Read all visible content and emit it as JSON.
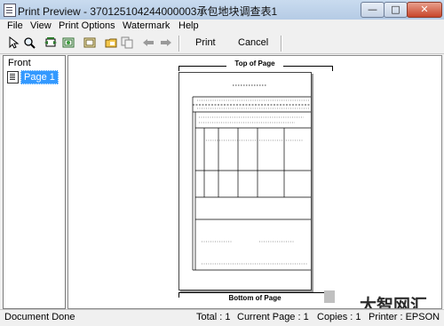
{
  "window": {
    "title": "Print Preview - 370125104244000003承包地块调查表1",
    "controls": {
      "minimize": "—",
      "maximize": "□",
      "close": "✕"
    }
  },
  "menu": [
    "File",
    "View",
    "Print Options",
    "Watermark",
    "Help"
  ],
  "toolbar": {
    "icons": [
      "pointer-icon",
      "zoom-icon",
      "fit-width-icon",
      "image-icon",
      "page-icon",
      "folder-icon",
      "copy-icon",
      "back-arrow-icon",
      "forward-arrow-icon"
    ],
    "print_label": "Print",
    "cancel_label": "Cancel"
  },
  "tree": {
    "root_label": "Front",
    "items": [
      {
        "label": "Page 1",
        "selected": true
      }
    ]
  },
  "preview": {
    "top_marker": "Top of Page",
    "bottom_marker": "Bottom of Page"
  },
  "watermark_text": "大智网汇",
  "status": {
    "message": "Document Done",
    "total": "Total : 1",
    "current_page": "Current Page : 1",
    "copies": "Copies : 1",
    "printer": "Printer : EPSON"
  },
  "colors": {
    "selection": "#3399ff",
    "titlebar": "#c9dbef",
    "close_button": "#c8452a"
  }
}
